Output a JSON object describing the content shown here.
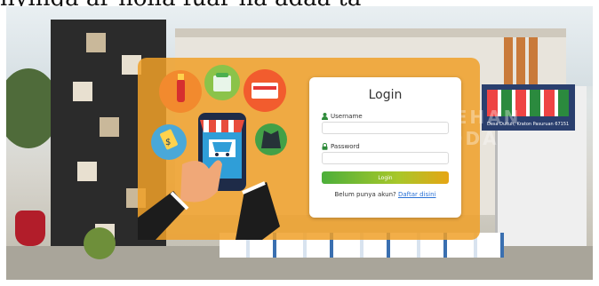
{
  "caption_fragment": "nyinga ar nolla fuar na adaa ta",
  "background": {
    "store_sign": "BAEHAN JADDA",
    "banner_text": "Desa Dukuh, Kraton Pasuruan 67151"
  },
  "login": {
    "title": "Login",
    "username_label": "Username",
    "password_label": "Password",
    "login_button": "Login",
    "register_prompt": "Belum punya akun?",
    "register_link": "Daftar disini"
  },
  "icons": {
    "username": "user-icon",
    "password": "lock-icon",
    "shop": "online-shop-icon"
  },
  "colors": {
    "overlay": "#f0a028",
    "link": "#2a72d6",
    "button_start": "#4caf3a",
    "button_end": "#e6a514",
    "user_icon": "#2e8b3a",
    "lock_icon": "#2e8b3a"
  }
}
